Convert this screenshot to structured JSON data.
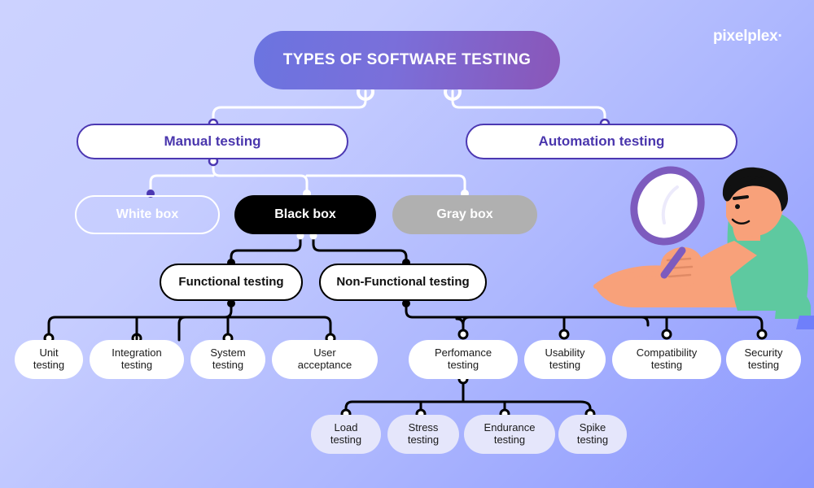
{
  "brand": {
    "logo_text": "pixelplex",
    "logo_dot": "·"
  },
  "title": {
    "label": "TYPES OF SOFTWARE TESTING"
  },
  "colors": {
    "background_start": "#ccd2ff",
    "background_end": "#8b97fd",
    "title_gradient_start": "#6b74e0",
    "title_gradient_end": "#8a56b8",
    "purple_border": "#4c38b2",
    "purple_text": "#4a36ad",
    "black_box": "#000000",
    "gray_box": "#b0b0b0",
    "white_line": "#ffffff",
    "leaf_tint": "#e5e6fb",
    "shirt_green": "#5ec9a0",
    "skin": "#f8a17a",
    "lens_purple": "#7d5bbe"
  },
  "level2": [
    {
      "label": "Manual testing"
    },
    {
      "label": "Automation testing"
    }
  ],
  "level3": [
    {
      "label": "White box",
      "style": "outline-white"
    },
    {
      "label": "Black box",
      "style": "solid-black"
    },
    {
      "label": "Gray box",
      "style": "solid-gray"
    }
  ],
  "level4": [
    {
      "label": "Functional testing"
    },
    {
      "label": "Non-Functional testing"
    }
  ],
  "functional_children": [
    {
      "line1": "Unit",
      "line2": "testing"
    },
    {
      "line1": "Integration",
      "line2": "testing"
    },
    {
      "line1": "System",
      "line2": "testing"
    },
    {
      "line1": "User",
      "line2": "acceptance"
    }
  ],
  "nonfunctional_children": [
    {
      "line1": "Perfomance",
      "line2": "testing"
    },
    {
      "line1": "Usability",
      "line2": "testing"
    },
    {
      "line1": "Compatibility",
      "line2": "testing"
    },
    {
      "line1": "Security",
      "line2": "testing"
    }
  ],
  "performance_children": [
    {
      "line1": "Load",
      "line2": "testing"
    },
    {
      "line1": "Stress",
      "line2": "testing"
    },
    {
      "line1": "Endurance",
      "line2": "testing"
    },
    {
      "line1": "Spike",
      "line2": "testing"
    }
  ]
}
